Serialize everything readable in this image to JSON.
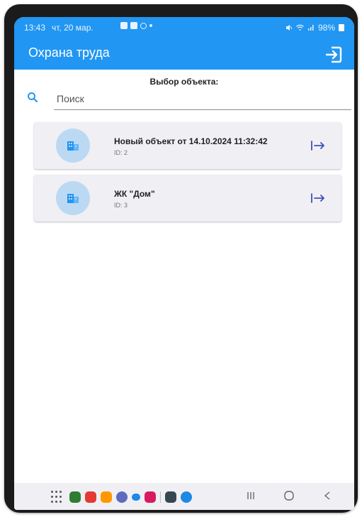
{
  "status_bar": {
    "time": "13:43",
    "date": "чт, 20 мар.",
    "battery": "98%"
  },
  "app": {
    "title": "Охрана труда",
    "logout_icon": "logout-icon"
  },
  "section": {
    "title": "Выбор объекта:"
  },
  "search": {
    "placeholder": "Поиск",
    "value": "",
    "icon": "search-icon"
  },
  "objects": [
    {
      "title": "Новый объект от 14.10.2024 11:32:42",
      "id": "ID: 2",
      "icon": "building-icon"
    },
    {
      "title": "ЖК \"Дом\"",
      "id": "ID: 3",
      "icon": "building-icon"
    }
  ],
  "colors": {
    "primary": "#2196f3",
    "card_bg": "#f0eff4",
    "avatar_bg": "#bcd9f3",
    "accent": "#3f51b5"
  },
  "nav_apps": [
    {
      "name": "phone",
      "color": "#2e7d32"
    },
    {
      "name": "messages",
      "color": "#e53935"
    },
    {
      "name": "gallery",
      "color": "#ff9800"
    },
    {
      "name": "samsung-internet",
      "color": "#5c6bc0"
    },
    {
      "name": "chat",
      "color": "#1e88e5"
    },
    {
      "name": "youtube",
      "color": "#d81b60"
    },
    {
      "name": "settings",
      "color": "#37474f"
    },
    {
      "name": "telegram",
      "color": "#1e88e5"
    }
  ]
}
